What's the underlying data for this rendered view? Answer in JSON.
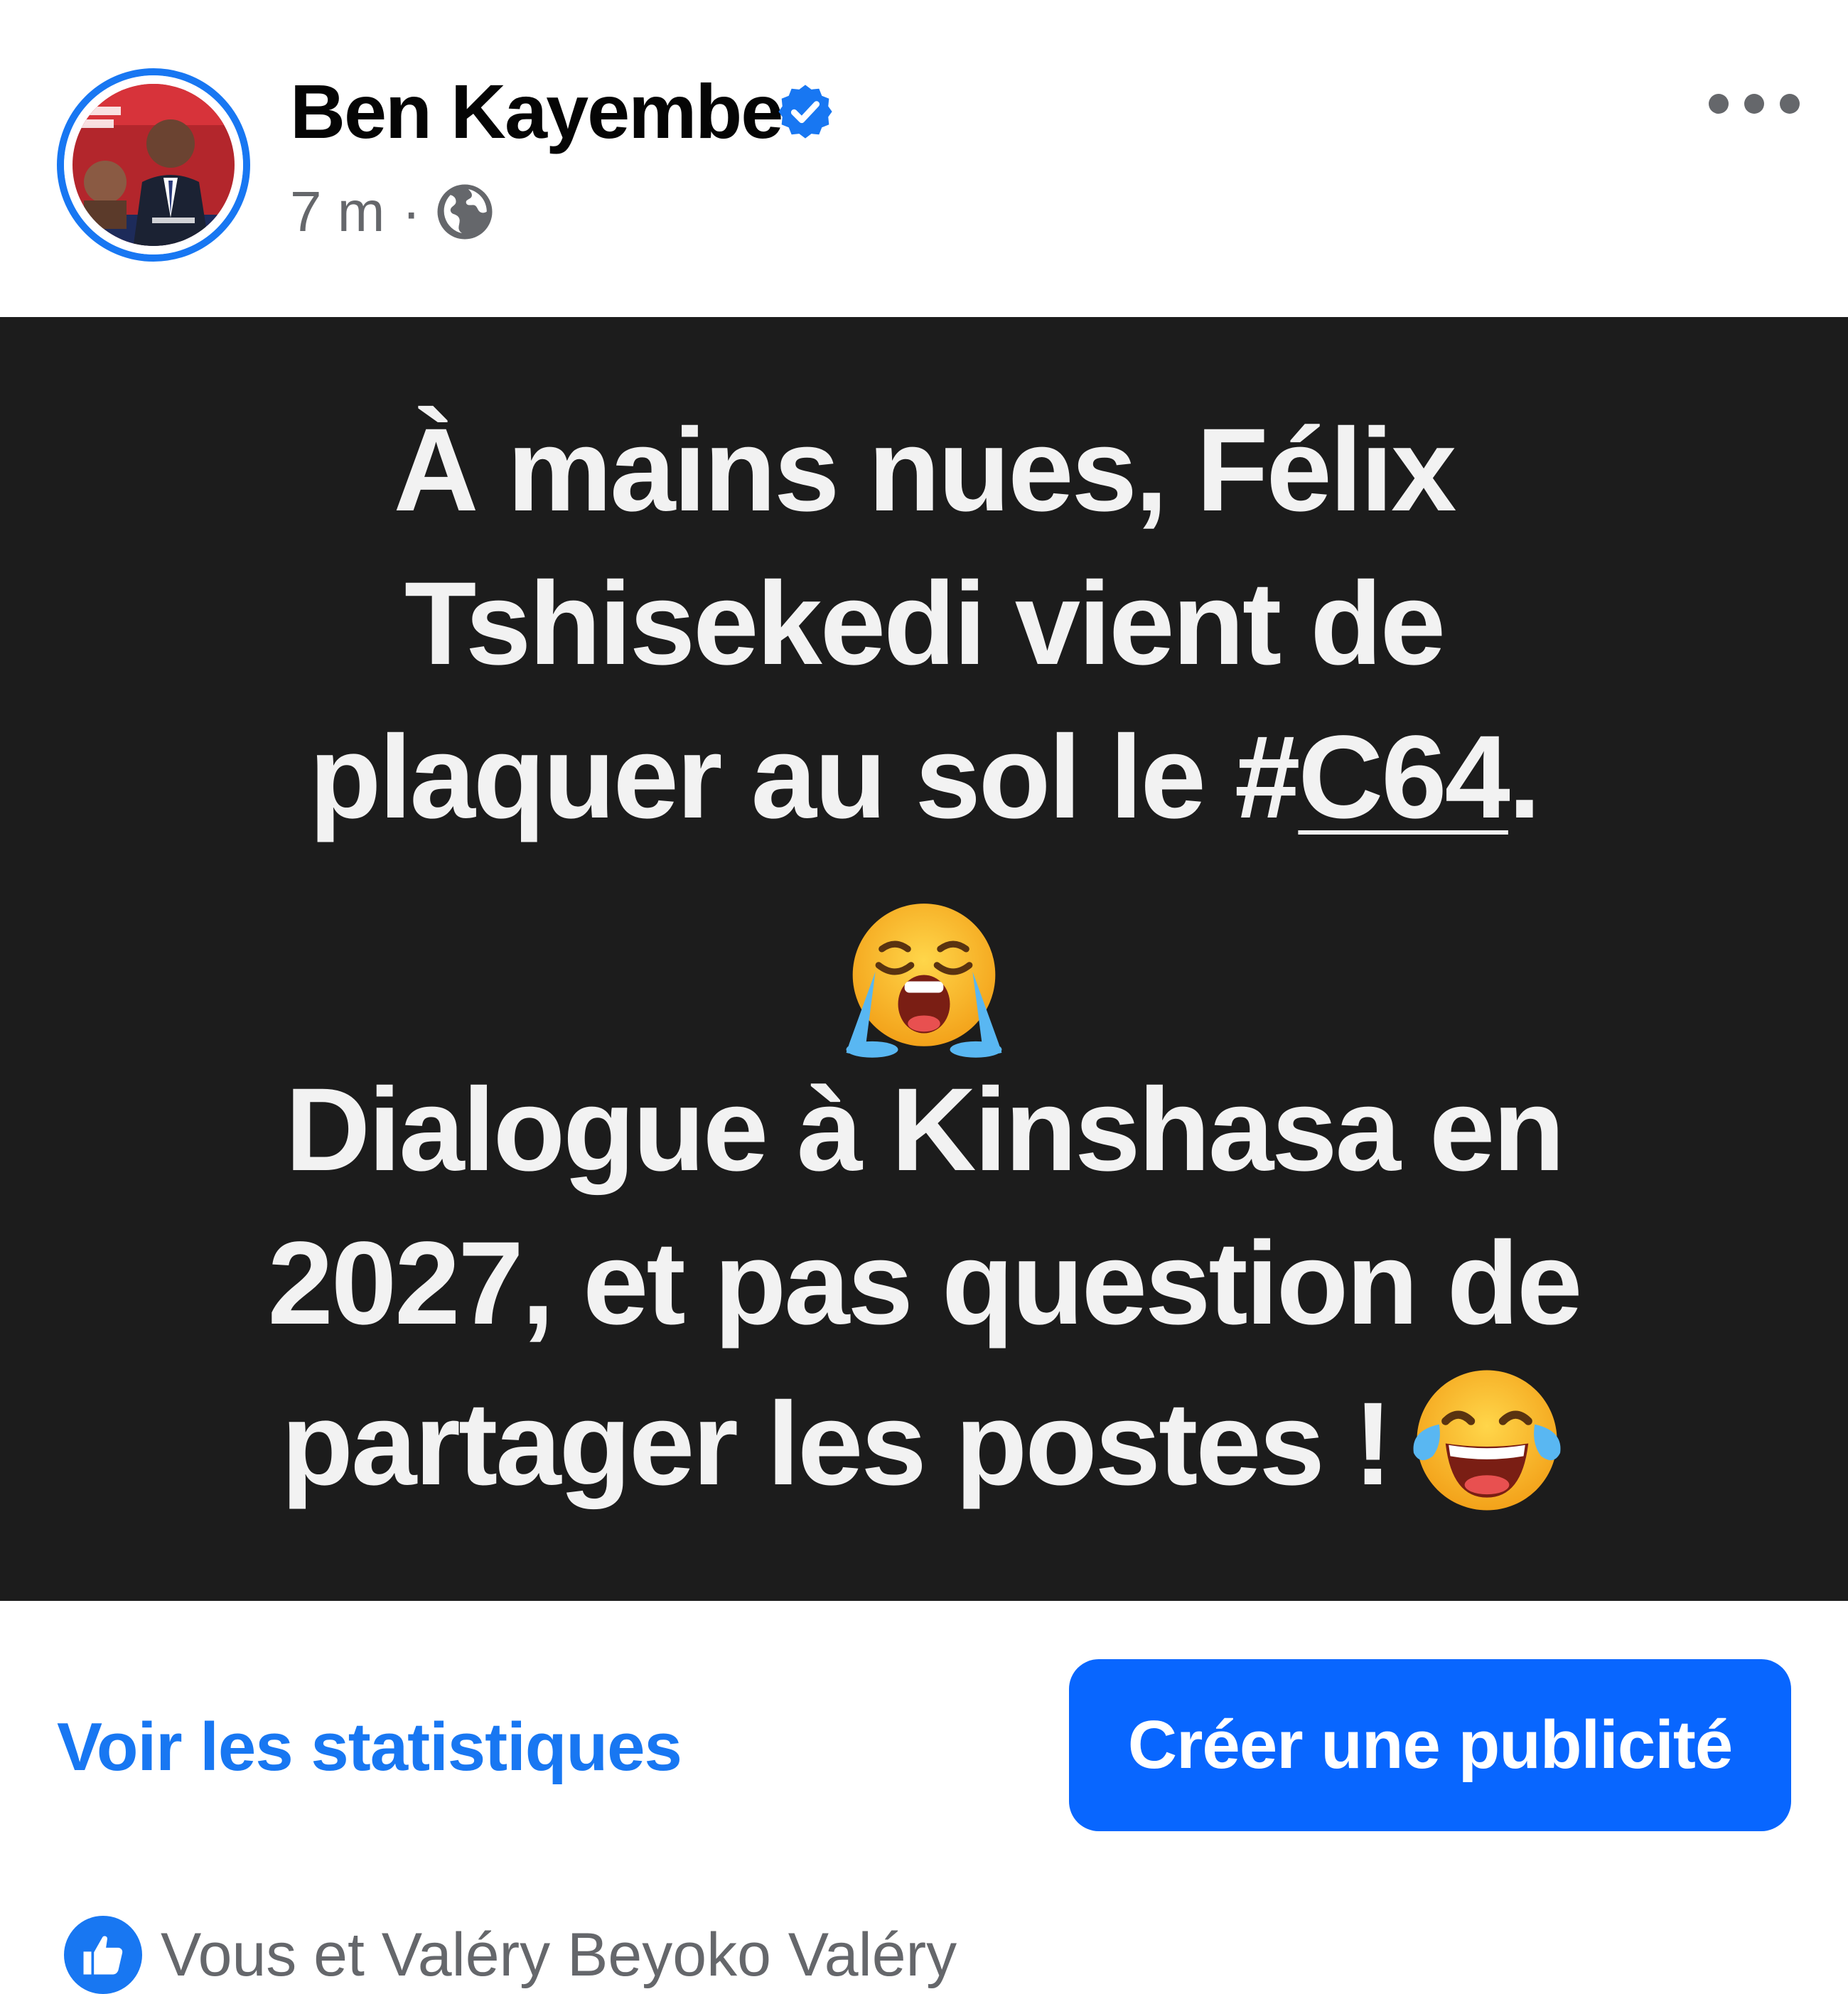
{
  "post": {
    "author": {
      "name": "Ben Kayembe",
      "avatar_icon": "avatar-photo",
      "verified_icon": "verified-badge-icon",
      "avatar_ring_color": "#1877f2"
    },
    "meta": {
      "time": "7 m",
      "separator": "·",
      "audience_icon": "globe-icon"
    },
    "menu_icon": "more-options-icon",
    "canvas": {
      "background": "#1c1c1c",
      "text_color": "#f2f2f2",
      "paragraph_1": {
        "line_1": "À mains nues, Félix",
        "line_2": "Tshisekedi vient de",
        "line_3_before": "plaquer au sol le ",
        "hashtag_symbol": "#",
        "hashtag_word": "C64",
        "line_3_after": "."
      },
      "emoji_1": "loudly-crying-face-emoji",
      "paragraph_2": {
        "line_1": "Dialogue à Kinshasa en",
        "line_2": "2027, et pas question de",
        "line_3": "partager les postes !",
        "emoji": "face-with-tears-of-joy-emoji"
      }
    },
    "actions": {
      "stats_label": "Voir les statistiques",
      "ad_button_label": "Créer une publicité",
      "accent_color": "#1877f2"
    },
    "reactions": {
      "icon": "like-icon",
      "text": "Vous et Valéry Beyoko Valéry"
    }
  }
}
